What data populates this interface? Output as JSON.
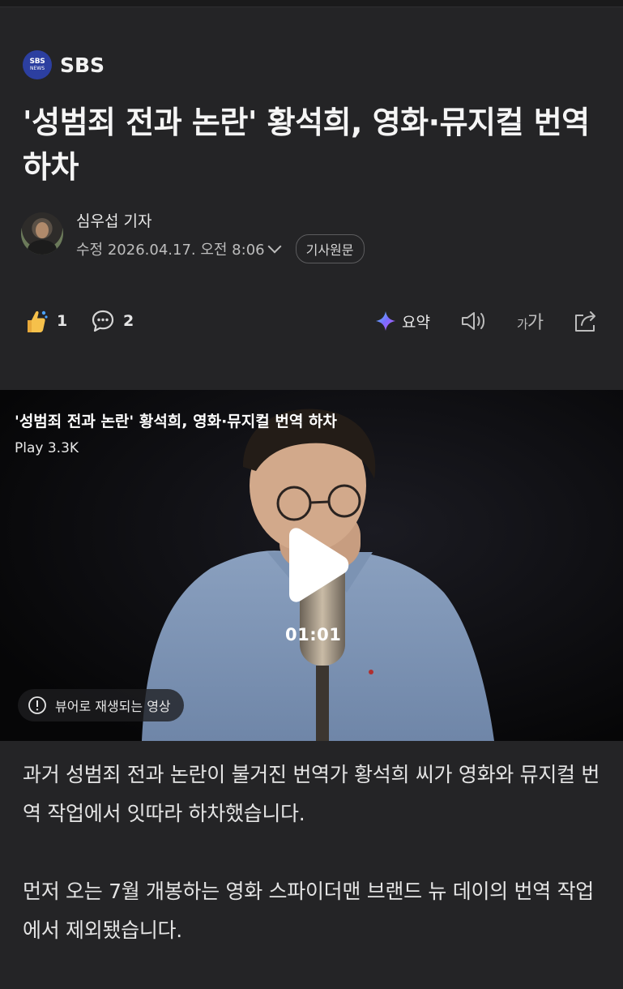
{
  "press": {
    "logo_line1": "SBS",
    "logo_line2": "NEWS",
    "name": "SBS"
  },
  "article": {
    "title": "'성범죄 전과 논란' 황석희, 영화·뮤지컬 번역 하차",
    "author": "심우섭 기자",
    "date": "수정 2026.04.17. 오전 8:06",
    "original_button": "기사원문"
  },
  "actions": {
    "like_count": "1",
    "comment_count": "2",
    "summary_label": "요약",
    "font_small": "가",
    "font_large": "가"
  },
  "video": {
    "title": "'성범죄 전과 논란' 황석희, 영화·뮤지컬 번역 하차",
    "plays": "Play 3.3K",
    "duration": "01:01",
    "preview_notice": "뷰어로 재생되는 영상"
  },
  "body": {
    "paragraphs": [
      "과거 성범죄 전과 논란이 불거진 번역가 황석희 씨가 영화와 뮤지컬 번역 작업에서 잇따라 하차했습니다.",
      "먼저 오는 7월 개봉하는 영화 스파이더맨 브랜드 뉴 데이의 번역 작업에서 제외됐습니다."
    ]
  },
  "colors": {
    "background": "#242426",
    "press_logo": "#2c3fa0",
    "ai_accent": "#6a5cff"
  }
}
